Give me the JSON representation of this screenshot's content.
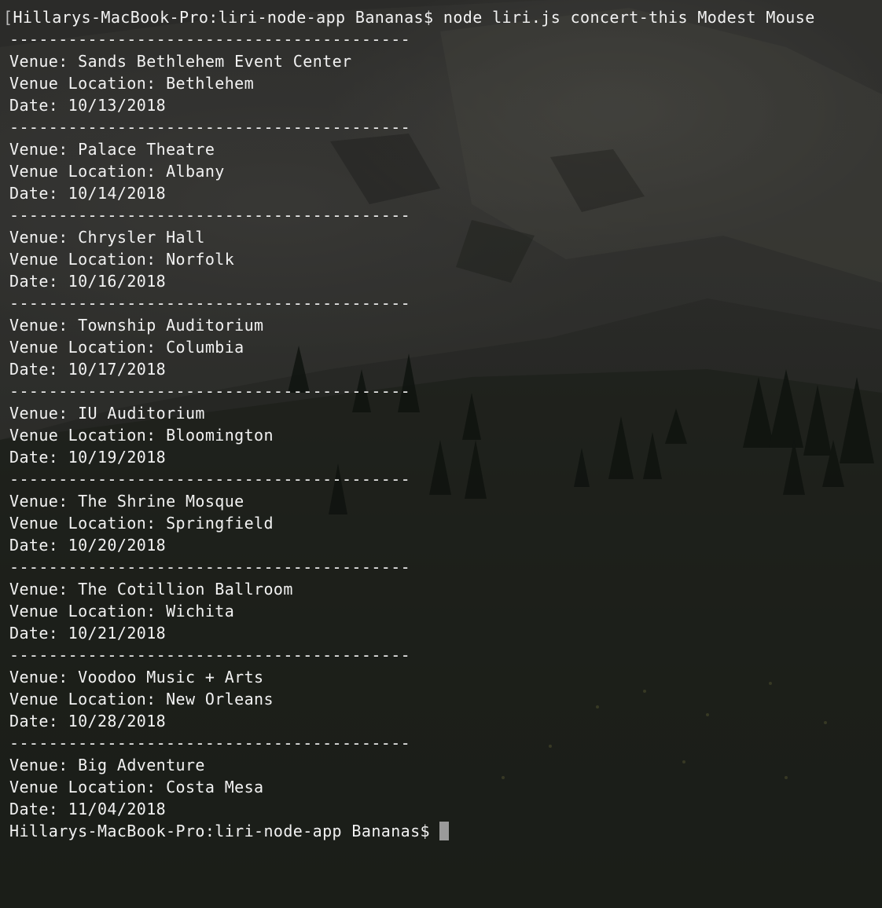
{
  "terminal": {
    "prompt": "Hillarys-MacBook-Pro:liri-node-app Bananas$",
    "command": "node liri.js concert-this Modest Mouse",
    "divider": "-----------------------------------------",
    "labels": {
      "venue": "Venue:",
      "location": "Venue Location:",
      "date": "Date:"
    },
    "events": [
      {
        "venue": "Sands Bethlehem Event Center",
        "location": "Bethlehem",
        "date": "10/13/2018"
      },
      {
        "venue": "Palace Theatre",
        "location": "Albany",
        "date": "10/14/2018"
      },
      {
        "venue": "Chrysler Hall",
        "location": "Norfolk",
        "date": "10/16/2018"
      },
      {
        "venue": "Township Auditorium",
        "location": "Columbia",
        "date": "10/17/2018"
      },
      {
        "venue": "IU Auditorium",
        "location": "Bloomington",
        "date": "10/19/2018"
      },
      {
        "venue": "The Shrine Mosque",
        "location": "Springfield",
        "date": "10/20/2018"
      },
      {
        "venue": "The Cotillion Ballroom",
        "location": "Wichita",
        "date": "10/21/2018"
      },
      {
        "venue": "Voodoo Music + Arts",
        "location": "New Orleans",
        "date": "10/28/2018"
      },
      {
        "venue": "Big Adventure",
        "location": "Costa Mesa",
        "date": "11/04/2018"
      }
    ]
  },
  "colors": {
    "text": "#f2f2f2",
    "cursor": "#9a9a9a",
    "background": "#1e1f1c"
  }
}
